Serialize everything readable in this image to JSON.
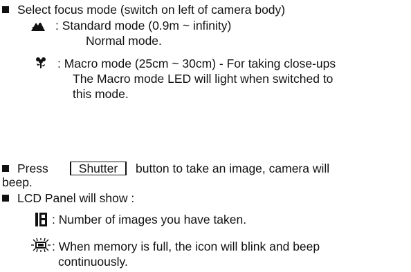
{
  "section1": {
    "heading": "Select focus mode (switch on left of camera body)",
    "standard": {
      "icon": "mountain-landscape-icon",
      "line1": ": Standard mode (0.9m ~ infinity)",
      "line2": "Normal mode."
    },
    "macro": {
      "icon": "flower-macro-icon",
      "line1": ": Macro mode (25cm ~ 30cm) - For taking close-ups",
      "line2": "The Macro mode LED will light when switched to",
      "line3": "this mode."
    }
  },
  "section2": {
    "before": "Press",
    "button_label": "Shutter",
    "after": "button to take an image, camera will",
    "wrap": "beep."
  },
  "section3": {
    "heading": "LCD Panel will show :",
    "count": {
      "icon": "lcd-digits-icon",
      "digits": "18",
      "text": ": Number of images you have taken."
    },
    "memory": {
      "icon": "memory-full-blink-icon",
      "line1": ": When memory is full, the icon will blink and beep",
      "line2": "continuously."
    }
  }
}
